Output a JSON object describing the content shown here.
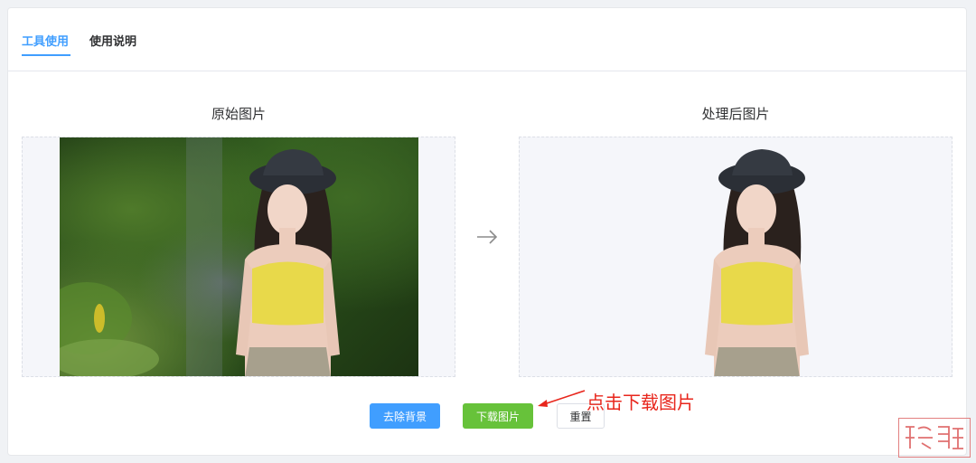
{
  "tabs": [
    {
      "label": "工具使用",
      "active": true
    },
    {
      "label": "使用说明",
      "active": false
    }
  ],
  "panels": {
    "original_title": "原始图片",
    "processed_title": "处理后图片"
  },
  "buttons": {
    "remove_bg": "去除背景",
    "download": "下载图片",
    "reset": "重置"
  },
  "annotation": "点击下载图片",
  "watermark": "",
  "colors": {
    "primary": "#409eff",
    "success": "#67c23a",
    "annotation": "#e8261c",
    "top_yellow": "#e8d94a",
    "hat": "#2b2f36"
  }
}
